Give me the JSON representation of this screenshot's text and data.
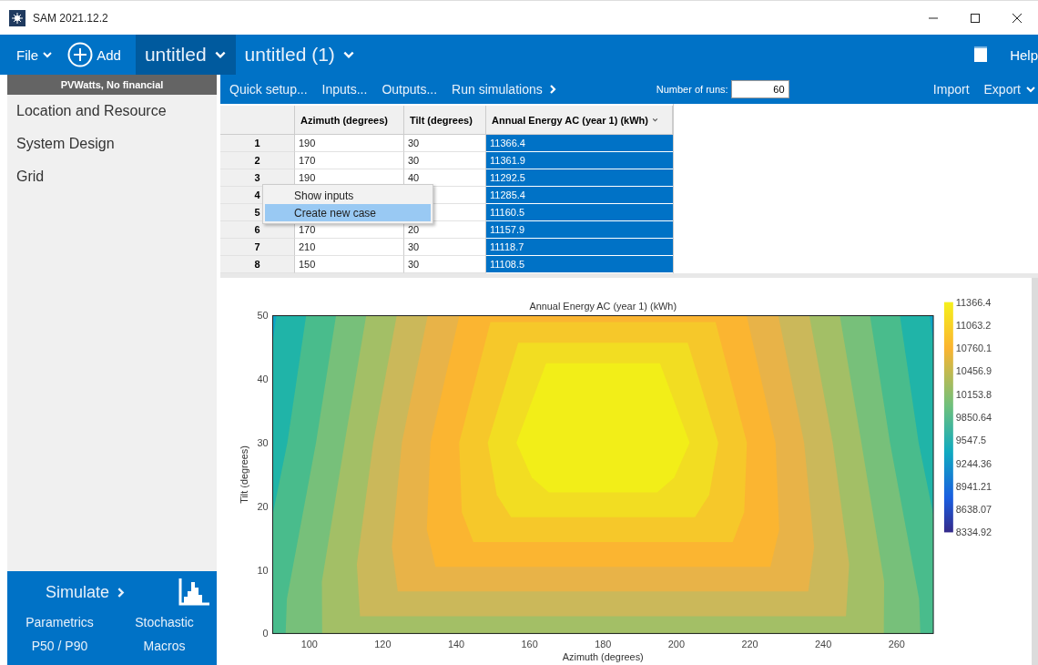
{
  "window": {
    "title": "SAM 2021.12.2"
  },
  "topbar": {
    "file": "File",
    "add": "Add",
    "help": "Help"
  },
  "cases": [
    {
      "label": "untitled",
      "selected": true
    },
    {
      "label": "untitled (1)",
      "selected": false
    }
  ],
  "sidebar": {
    "header": "PVWatts, No financial",
    "items": [
      "Location and Resource",
      "System Design",
      "Grid"
    ],
    "simulate": "Simulate",
    "links": [
      "Parametrics",
      "Stochastic",
      "P50 / P90",
      "Macros"
    ]
  },
  "toolbar": {
    "items": [
      "Quick setup...",
      "Inputs...",
      "Outputs..."
    ],
    "run": "Run simulations",
    "runs_label": "Number of runs:",
    "runs_value": "60",
    "import": "Import",
    "export": "Export"
  },
  "table": {
    "columns": [
      "Azimuth (degrees)",
      "Tilt (degrees)",
      "Annual Energy AC (year 1) (kWh)"
    ],
    "rows": [
      {
        "num": "1",
        "azimuth": "190",
        "tilt": "30",
        "energy": "11366.4",
        "selected": true
      },
      {
        "num": "2",
        "azimuth": "170",
        "tilt": "30",
        "energy": "11361.9",
        "selected": true
      },
      {
        "num": "3",
        "azimuth": "190",
        "tilt": "40",
        "energy": "11292.5",
        "selected": true
      },
      {
        "num": "4",
        "energy": "11285.4",
        "selected": true
      },
      {
        "num": "5",
        "energy": "11160.5",
        "selected": true
      },
      {
        "num": "6",
        "azimuth": "170",
        "tilt": "20",
        "energy": "11157.9",
        "selected": true
      },
      {
        "num": "7",
        "azimuth": "210",
        "tilt": "30",
        "energy": "11118.7",
        "selected": true
      },
      {
        "num": "8",
        "azimuth": "150",
        "tilt": "30",
        "energy": "11108.5",
        "selected": true
      }
    ]
  },
  "context_menu": [
    {
      "label": "Show inputs",
      "selected": false
    },
    {
      "label": "Create new case",
      "selected": true
    }
  ],
  "contour_plot": {
    "title": "Annual Energy AC (year 1) (kWh)",
    "xlabel": "Azimuth (degrees)",
    "ylabel": "Tilt (degrees)",
    "xticks": [
      "100",
      "120",
      "140",
      "160",
      "180",
      "200",
      "220",
      "240",
      "260"
    ],
    "yticks": [
      "50",
      "40",
      "30",
      "20",
      "10",
      "0"
    ],
    "colorbar_labels": [
      "11366.4",
      "11063.2",
      "10760.1",
      "10456.9",
      "10153.8",
      "9850.64",
      "9547.5",
      "9244.36",
      "8941.21",
      "8638.07",
      "8334.92"
    ]
  }
}
